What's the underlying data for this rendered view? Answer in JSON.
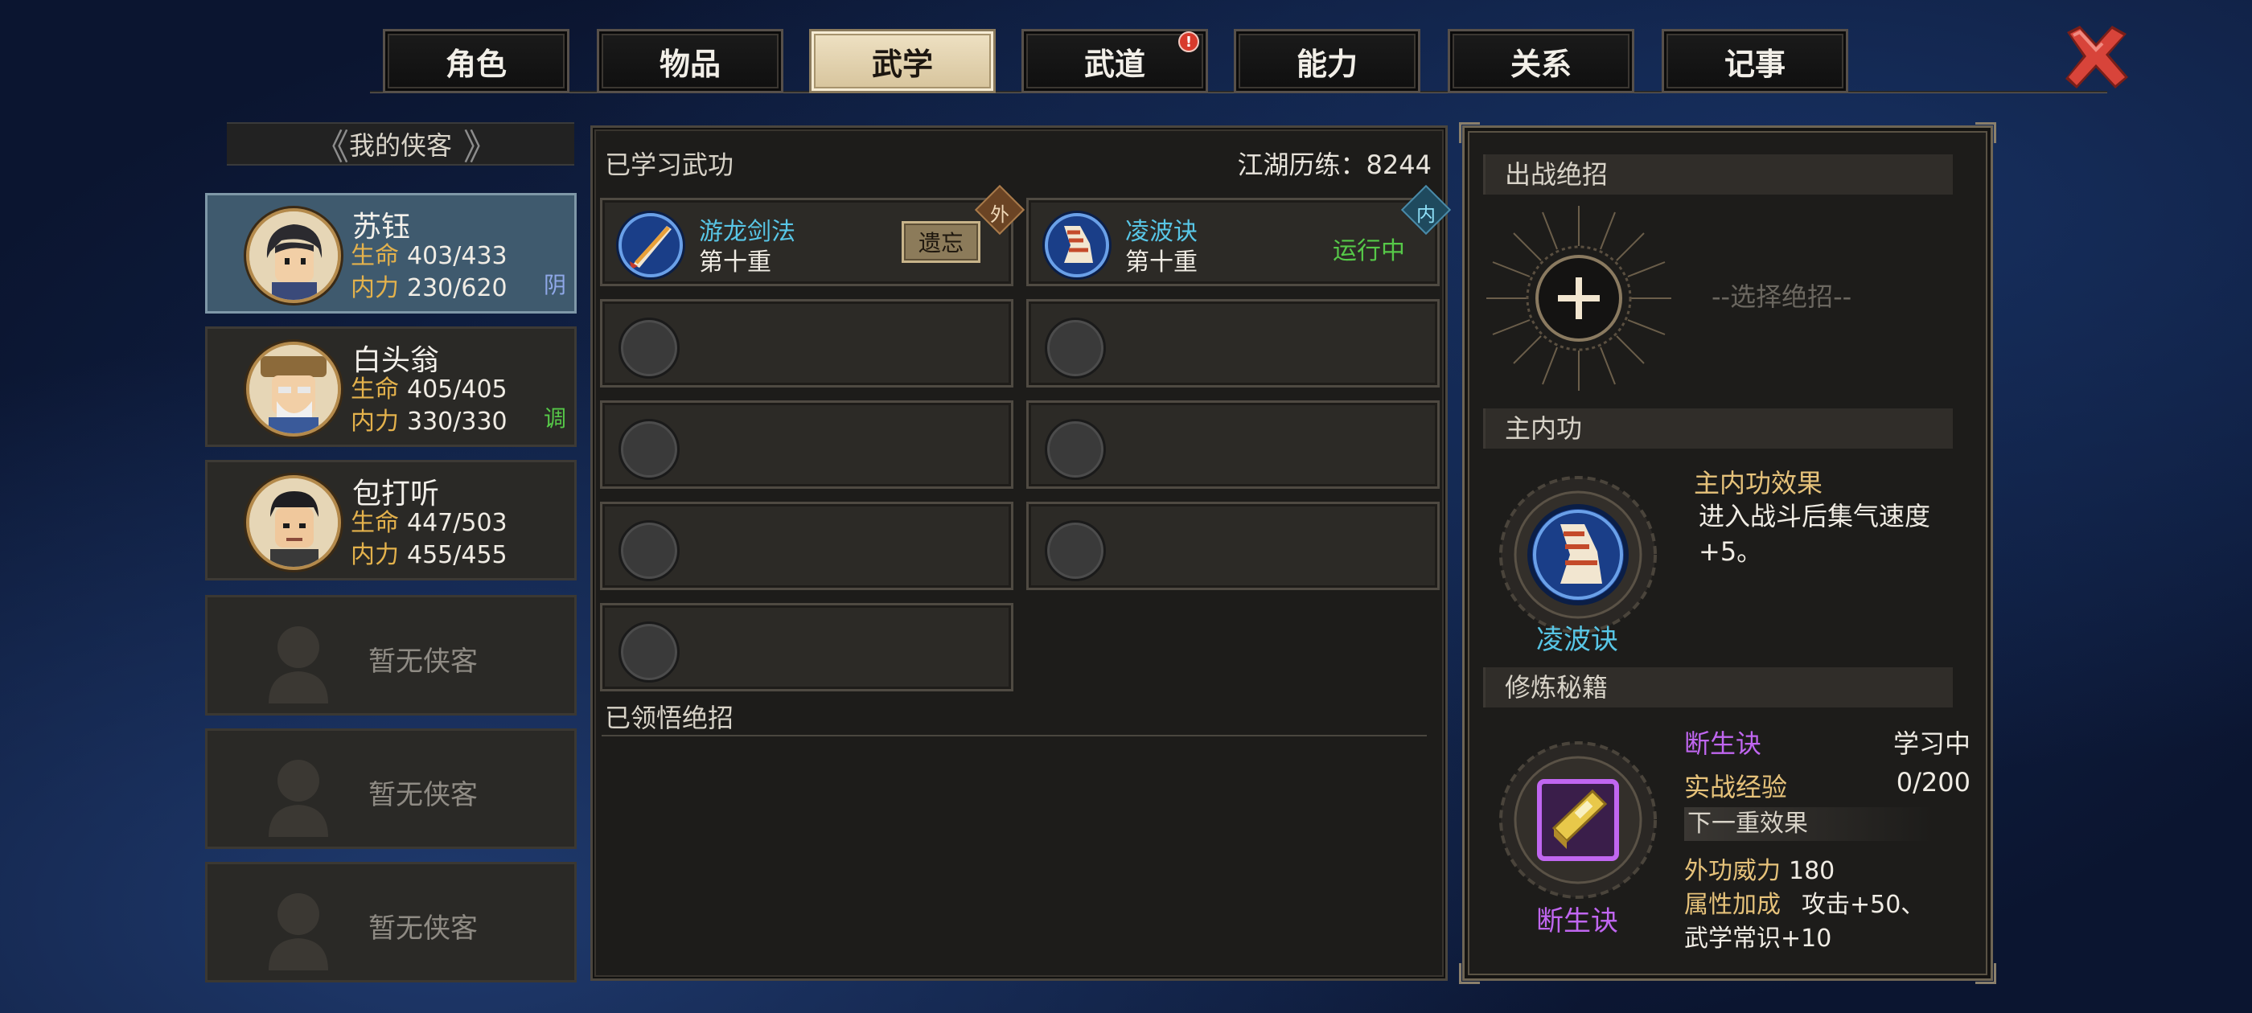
{
  "tabs": [
    {
      "label": "角色"
    },
    {
      "label": "物品"
    },
    {
      "label": "武学",
      "active": true
    },
    {
      "label": "武道",
      "badge": "!"
    },
    {
      "label": "能力"
    },
    {
      "label": "关系"
    },
    {
      "label": "记事"
    }
  ],
  "roster": {
    "header": "我的侠客",
    "characters": [
      {
        "name": "苏钰",
        "hp_label": "生命",
        "hp": "403/433",
        "mp_label": "内力",
        "mp": "230/620",
        "tag": "阴",
        "tag_color": "#8fa8e8",
        "selected": true
      },
      {
        "name": "白头翁",
        "hp_label": "生命",
        "hp": "405/405",
        "mp_label": "内力",
        "mp": "330/330",
        "tag": "调",
        "tag_color": "#56c848"
      },
      {
        "name": "包打听",
        "hp_label": "生命",
        "hp": "447/503",
        "mp_label": "内力",
        "mp": "455/455",
        "tag": ""
      }
    ],
    "empty_label": "暂无侠客"
  },
  "skills": {
    "title": "已学习武功",
    "exp_label": "江湖历练：8244",
    "learned": [
      {
        "name": "游龙剑法",
        "level": "第十重",
        "corner": "外",
        "corner_color": "#8a5a32",
        "corner_text": "#f0d9b8",
        "button": "遗忘",
        "icon": "sword-icon"
      },
      {
        "name": "凌波诀",
        "level": "第十重",
        "corner": "内",
        "corner_color": "#2a6a8a",
        "corner_text": "#8fe0f8",
        "status": "运行中",
        "icon": "boot-icon"
      }
    ],
    "ultimates_title": "已领悟绝招"
  },
  "right": {
    "ult_section": "出战绝招",
    "ult_placeholder": "--选择绝招--",
    "inner_section": "主内功",
    "inner_name": "凌波诀",
    "inner_effect_title": "主内功效果",
    "inner_effect_desc": "进入战斗后集气速度+5。",
    "book_section": "修炼秘籍",
    "book_name": "断生诀",
    "book_status": "学习中",
    "exp_label": "实战经验",
    "exp_value": "0/200",
    "next_label": "下一重效果",
    "power_label": "外功威力",
    "power_value": "180",
    "attr_label": "属性加成",
    "attr_value1": "攻击+50、",
    "attr_value2": "武学常识+10"
  },
  "colors": {
    "accent_gold": "#e4b24c",
    "skill_name": "#58c6e6",
    "book_purple": "#c066f0",
    "running_green": "#56c848",
    "close_red": "#d8443a"
  }
}
